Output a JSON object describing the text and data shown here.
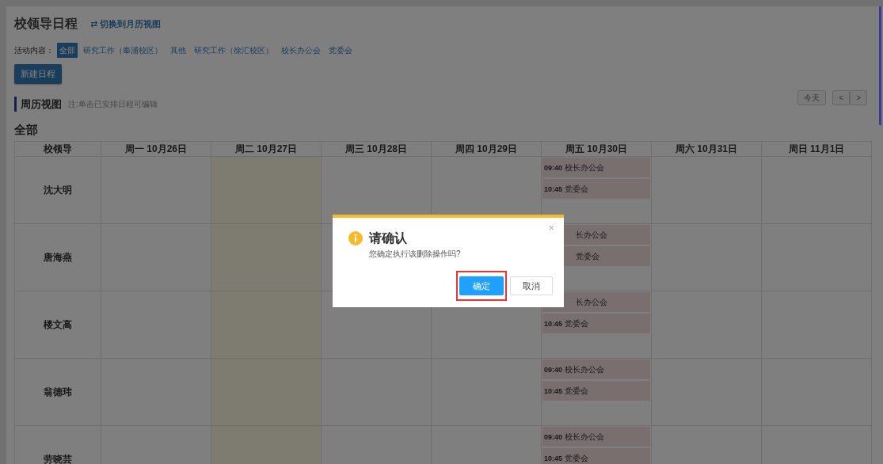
{
  "page": {
    "title": "校领导日程",
    "switch_link": {
      "icon": "⇄",
      "label": "切换到月历视图"
    }
  },
  "filter": {
    "label": "活动内容：",
    "options": [
      {
        "label": "全部",
        "selected": true
      },
      {
        "label": "研究工作（奉浦校区）",
        "selected": false
      },
      {
        "label": "其他",
        "selected": false
      },
      {
        "label": "研究工作（徐汇校区）",
        "selected": false
      },
      {
        "label": "校长办公会",
        "selected": false
      },
      {
        "label": "党委会",
        "selected": false
      }
    ]
  },
  "new_button": "新建日程",
  "view": {
    "title": "周历视图",
    "note": "注:单击已安排日程可编辑"
  },
  "nav": {
    "today": "今天",
    "prev": "<",
    "next": ">"
  },
  "group_title": "全部",
  "table": {
    "columns": [
      {
        "label": "校领导",
        "today": false
      },
      {
        "label": "周一 10月26日",
        "today": false
      },
      {
        "label": "周二 10月27日",
        "today": true
      },
      {
        "label": "周三 10月28日",
        "today": false
      },
      {
        "label": "周四 10月29日",
        "today": false
      },
      {
        "label": "周五 10月30日",
        "today": false
      },
      {
        "label": "周六 10月31日",
        "today": false
      },
      {
        "label": "周日 11月1日",
        "today": false
      }
    ],
    "rows": [
      {
        "name": "沈大明",
        "cells": [
          {},
          {},
          {},
          {},
          {
            "events": [
              {
                "kind": "full",
                "time": "09:40",
                "title": "校长办公会"
              },
              {
                "kind": "full",
                "time": "10:45",
                "title": "党委会"
              }
            ]
          },
          {},
          {}
        ]
      },
      {
        "name": "唐海燕",
        "cells": [
          {},
          {},
          {},
          {},
          {
            "events": [
              {
                "kind": "covered",
                "title": "长办公会"
              },
              {
                "kind": "covered",
                "title": "党委会"
              }
            ]
          },
          {},
          {}
        ]
      },
      {
        "name": "楼文高",
        "cells": [
          {},
          {},
          {},
          {},
          {
            "events": [
              {
                "kind": "covered",
                "title": "长办公会"
              },
              {
                "kind": "full",
                "time": "10:45",
                "title": "党委会"
              }
            ]
          },
          {},
          {}
        ]
      },
      {
        "name": "翁德玮",
        "cells": [
          {},
          {},
          {},
          {},
          {
            "events": [
              {
                "kind": "full",
                "time": "09:40",
                "title": "校长办公会"
              },
              {
                "kind": "full",
                "time": "10:45",
                "title": "党委会"
              }
            ]
          },
          {},
          {}
        ]
      },
      {
        "name": "劳晓芸",
        "cells": [
          {},
          {},
          {},
          {},
          {
            "events": [
              {
                "kind": "full",
                "time": "09:40",
                "title": "校长办公会"
              },
              {
                "kind": "full",
                "time": "10:45",
                "title": "党委会"
              }
            ]
          },
          {},
          {}
        ]
      }
    ]
  },
  "dialog": {
    "title": "请确认",
    "message": "您确定执行该删除操作吗?",
    "close": "×",
    "buttons": [
      {
        "label": "确定",
        "kind": "primary",
        "highlighted": true
      },
      {
        "label": "取消",
        "kind": "default",
        "highlighted": false
      }
    ]
  }
}
